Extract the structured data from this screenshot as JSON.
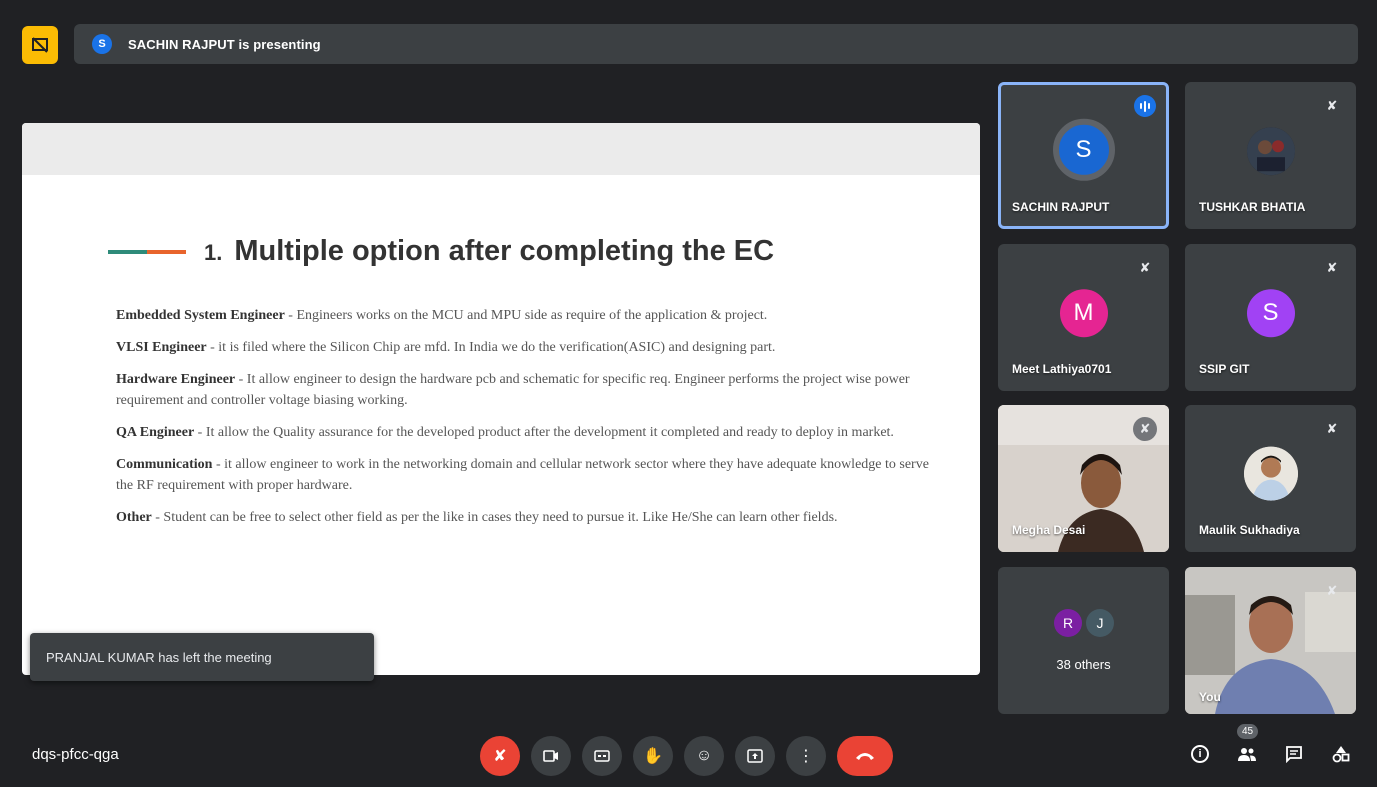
{
  "presentation": {
    "presenter_initial": "S",
    "presenting_text": "SACHIN RAJPUT is presenting"
  },
  "slide": {
    "number": "1.",
    "title": "Multiple option after completing the EC",
    "items": [
      {
        "term": "Embedded System Engineer",
        "text": " - Engineers works on the MCU and MPU side as require of the application & project."
      },
      {
        "term": "VLSI Engineer",
        "text": " - it is filed where the Silicon Chip are mfd. In India we do the verification(ASIC) and designing part."
      },
      {
        "term": "Hardware Engineer",
        "text": " - It allow engineer to design the hardware pcb and schematic for specific req. Engineer performs the project wise power requirement and controller voltage biasing working."
      },
      {
        "term": "QA Engineer",
        "text": " -  It allow the Quality assurance for the developed product after the development it completed and ready to deploy in market."
      },
      {
        "term": "Communication",
        "text": " - it allow engineer to work in the networking domain and cellular network sector where they have adequate knowledge to serve the RF requirement with proper hardware."
      },
      {
        "term": "Other",
        "text": " - Student can be free to select other field as per the  like in cases they need to pursue it. Like He/She can learn other fields."
      }
    ]
  },
  "toast": "PRANJAL KUMAR has left the meeting",
  "participants": {
    "sachin": {
      "name": "SACHIN RAJPUT",
      "initial": "S",
      "color": "#1967d2"
    },
    "tushkar": {
      "name": "TUSHKAR BHATIA"
    },
    "meet": {
      "name": "Meet Lathiya0701",
      "initial": "M",
      "color": "#e52592"
    },
    "ssip": {
      "name": "SSIP GIT",
      "initial": "S",
      "color": "#a142f4"
    },
    "megha": {
      "name": "Megha Desai"
    },
    "maulik": {
      "name": "Maulik Sukhadiya"
    },
    "others": {
      "label": "38 others",
      "initial_1": "R",
      "initial_2": "J"
    },
    "you": {
      "name": "You"
    }
  },
  "meeting_code": "dqs-pfcc-qga",
  "people_count": "45",
  "colors": {
    "accent": "#1a73e8",
    "danger": "#ea4335",
    "pin": "#fbbc04"
  }
}
